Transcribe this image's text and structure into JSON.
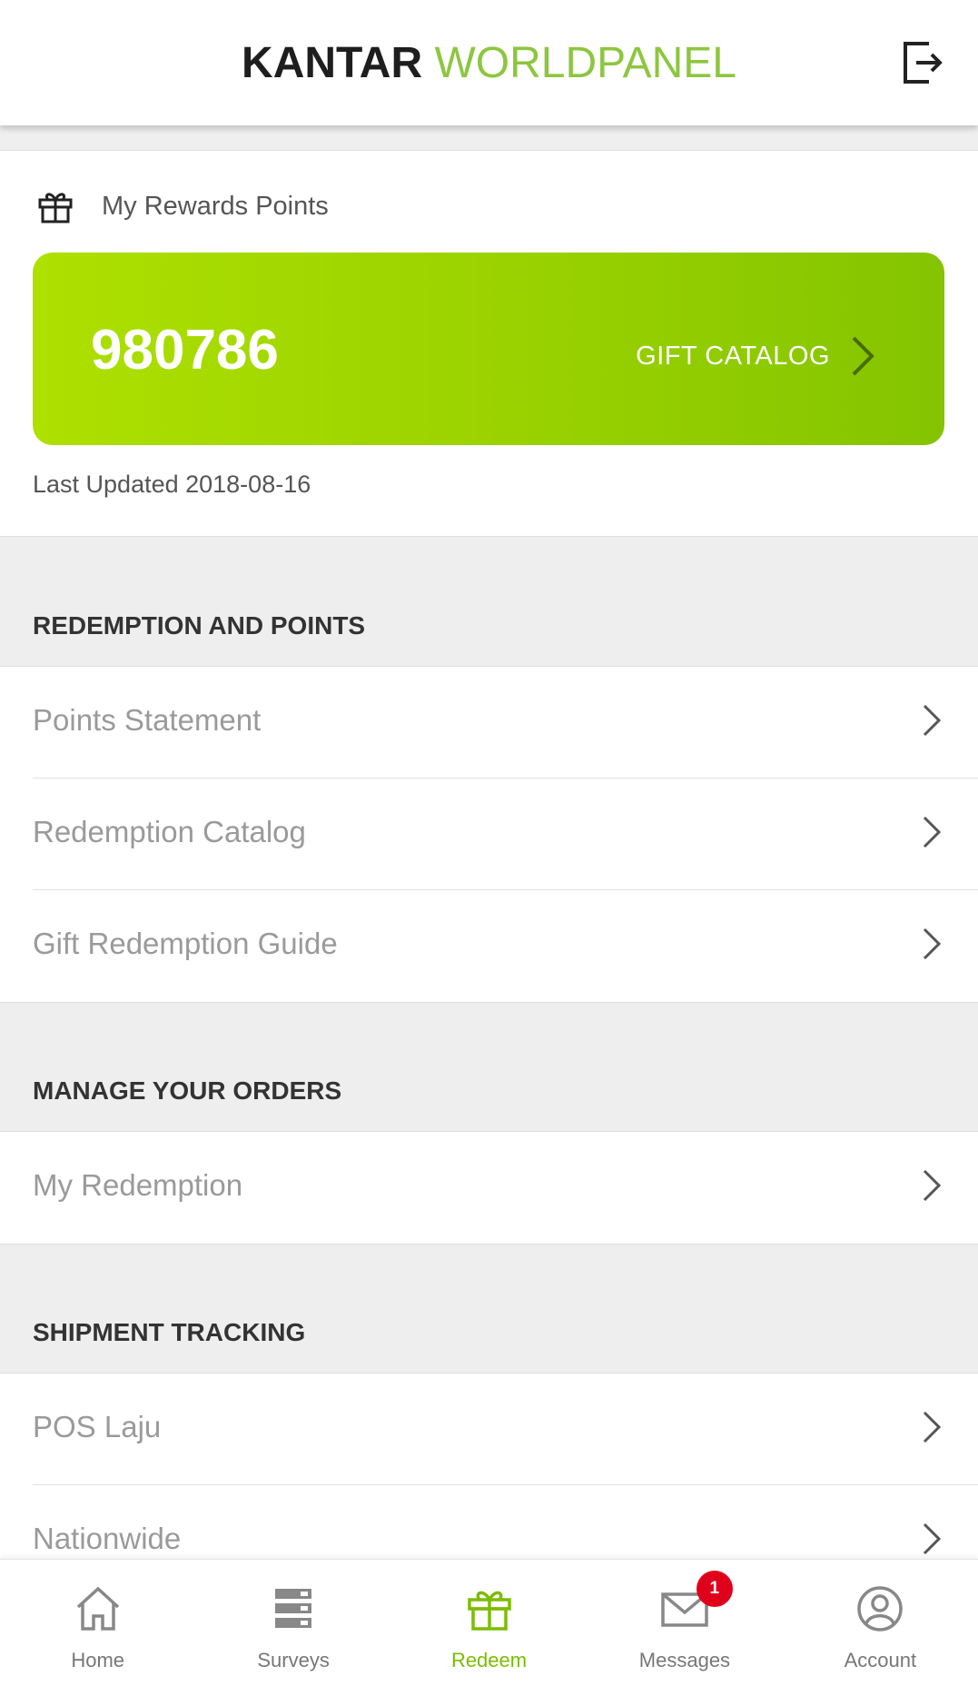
{
  "header": {
    "brand": "KANTAR",
    "sub_brand": "WORLDPANEL",
    "logout_icon": "logout-icon"
  },
  "rewards": {
    "title": "My Rewards Points",
    "points": "980786",
    "gift_catalog_label": "GIFT CATALOG",
    "last_updated": "Last Updated 2018-08-16"
  },
  "sections": {
    "redemption": {
      "title": "REDEMPTION AND POINTS",
      "items": [
        "Points Statement",
        "Redemption Catalog",
        "Gift Redemption Guide"
      ]
    },
    "orders": {
      "title": "MANAGE YOUR ORDERS",
      "items": [
        "My Redemption"
      ]
    },
    "shipment": {
      "title": "SHIPMENT TRACKING",
      "items": [
        "POS Laju",
        "Nationwide"
      ]
    }
  },
  "nav": {
    "items": [
      {
        "label": "Home",
        "icon": "home-icon"
      },
      {
        "label": "Surveys",
        "icon": "surveys-icon"
      },
      {
        "label": "Redeem",
        "icon": "gift-icon",
        "active": true
      },
      {
        "label": "Messages",
        "icon": "mail-icon",
        "badge": "1"
      },
      {
        "label": "Account",
        "icon": "account-icon"
      }
    ]
  },
  "colors": {
    "accent": "#8dc63f",
    "card_start": "#aee000",
    "card_end": "#84c400",
    "badge": "#e0001b"
  }
}
